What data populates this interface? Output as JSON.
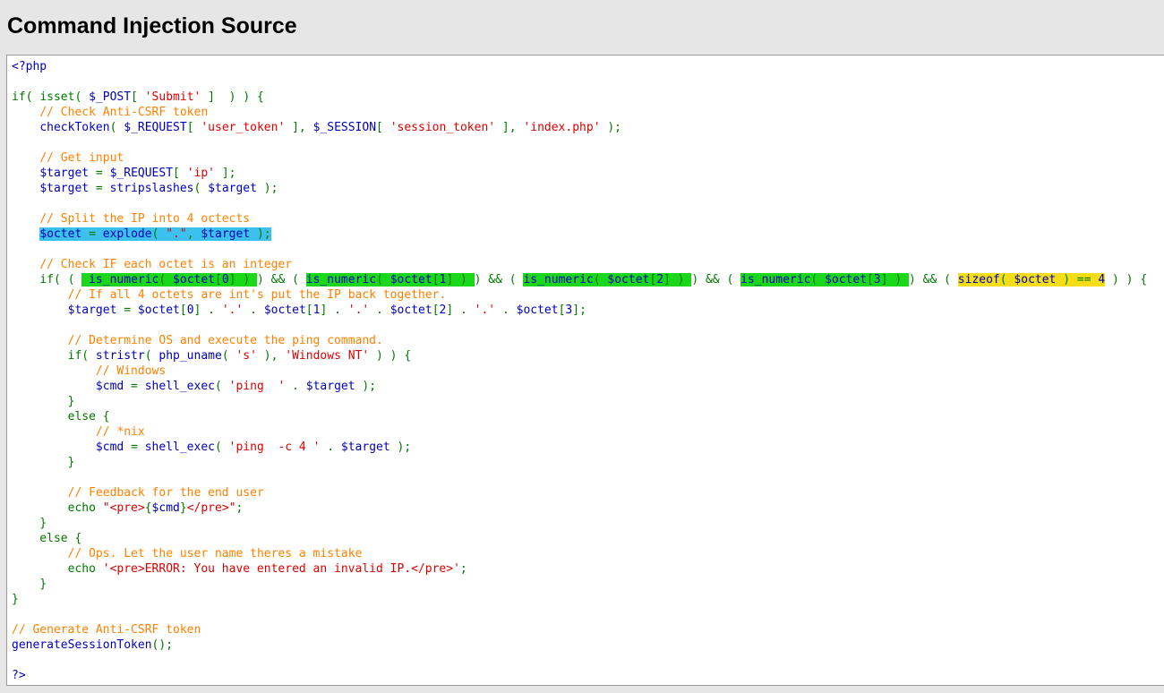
{
  "page": {
    "title": "Command Injection Source"
  },
  "colors": {
    "keyword": "#007700",
    "default": "#0000bb",
    "string": "#dd0000",
    "comment": "#ff8000",
    "highlight_blue": "#3cc1ee",
    "highlight_green": "#1ad71a",
    "highlight_yellow": "#f5dd17"
  },
  "code": {
    "lines": [
      [
        {
          "t": "<?php",
          "c": "dk"
        }
      ],
      [],
      [
        {
          "t": "if( ",
          "c": "kw"
        },
        {
          "t": "isset",
          "c": "kw"
        },
        {
          "t": "( ",
          "c": "kw"
        },
        {
          "t": "$_POST",
          "c": "dk"
        },
        {
          "t": "[ ",
          "c": "kw"
        },
        {
          "t": "'Submit'",
          "c": "str"
        },
        {
          "t": " ]  ) ) {",
          "c": "kw"
        }
      ],
      [
        {
          "t": "    ",
          "c": "kw"
        },
        {
          "t": "// Check Anti-CSRF token",
          "c": "cm"
        }
      ],
      [
        {
          "t": "    ",
          "c": "kw"
        },
        {
          "t": "checkToken",
          "c": "dk"
        },
        {
          "t": "( ",
          "c": "kw"
        },
        {
          "t": "$_REQUEST",
          "c": "dk"
        },
        {
          "t": "[ ",
          "c": "kw"
        },
        {
          "t": "'user_token'",
          "c": "str"
        },
        {
          "t": " ], ",
          "c": "kw"
        },
        {
          "t": "$_SESSION",
          "c": "dk"
        },
        {
          "t": "[ ",
          "c": "kw"
        },
        {
          "t": "'session_token'",
          "c": "str"
        },
        {
          "t": " ], ",
          "c": "kw"
        },
        {
          "t": "'index.php'",
          "c": "str"
        },
        {
          "t": " );",
          "c": "kw"
        }
      ],
      [],
      [
        {
          "t": "    ",
          "c": "kw"
        },
        {
          "t": "// Get input",
          "c": "cm"
        }
      ],
      [
        {
          "t": "    ",
          "c": "kw"
        },
        {
          "t": "$target",
          "c": "dk"
        },
        {
          "t": " = ",
          "c": "kw"
        },
        {
          "t": "$_REQUEST",
          "c": "dk"
        },
        {
          "t": "[ ",
          "c": "kw"
        },
        {
          "t": "'ip'",
          "c": "str"
        },
        {
          "t": " ];",
          "c": "kw"
        }
      ],
      [
        {
          "t": "    ",
          "c": "kw"
        },
        {
          "t": "$target",
          "c": "dk"
        },
        {
          "t": " = ",
          "c": "kw"
        },
        {
          "t": "stripslashes",
          "c": "dk"
        },
        {
          "t": "( ",
          "c": "kw"
        },
        {
          "t": "$target",
          "c": "dk"
        },
        {
          "t": " );",
          "c": "kw"
        }
      ],
      [],
      [
        {
          "t": "    ",
          "c": "kw"
        },
        {
          "t": "// Split the IP into 4 octects",
          "c": "cm"
        }
      ],
      [
        {
          "t": "    ",
          "c": "kw"
        },
        {
          "t": "$octet",
          "c": "dk",
          "h": "blue"
        },
        {
          "t": " = ",
          "c": "kw",
          "h": "blue"
        },
        {
          "t": "explode",
          "c": "dk",
          "h": "blue"
        },
        {
          "t": "( ",
          "c": "kw",
          "h": "blue"
        },
        {
          "t": "\".\"",
          "c": "str",
          "h": "blue"
        },
        {
          "t": ", ",
          "c": "kw",
          "h": "blue"
        },
        {
          "t": "$target",
          "c": "dk",
          "h": "blue"
        },
        {
          "t": " );",
          "c": "kw",
          "h": "blue"
        }
      ],
      [],
      [
        {
          "t": "    ",
          "c": "kw"
        },
        {
          "t": "// Check IF each octet is an integer",
          "c": "cm"
        }
      ],
      [
        {
          "t": "    if( ( ",
          "c": "kw"
        },
        {
          "t": " ",
          "c": "kw",
          "h": "green"
        },
        {
          "t": "is_numeric",
          "c": "dk",
          "h": "green"
        },
        {
          "t": "( ",
          "c": "kw",
          "h": "green"
        },
        {
          "t": "$octet",
          "c": "dk",
          "h": "green"
        },
        {
          "t": "[",
          "c": "kw",
          "h": "green"
        },
        {
          "t": "0",
          "c": "dk",
          "h": "green"
        },
        {
          "t": "] ) ",
          "c": "kw",
          "h": "green"
        },
        {
          "t": ") && ( ",
          "c": "kw"
        },
        {
          "t": "is_numeric",
          "c": "dk",
          "h": "green"
        },
        {
          "t": "( ",
          "c": "kw",
          "h": "green"
        },
        {
          "t": "$octet",
          "c": "dk",
          "h": "green"
        },
        {
          "t": "[",
          "c": "kw",
          "h": "green"
        },
        {
          "t": "1",
          "c": "dk",
          "h": "green"
        },
        {
          "t": "] ) ",
          "c": "kw",
          "h": "green"
        },
        {
          "t": ") && ( ",
          "c": "kw"
        },
        {
          "t": "is_numeric",
          "c": "dk",
          "h": "green"
        },
        {
          "t": "( ",
          "c": "kw",
          "h": "green"
        },
        {
          "t": "$octet",
          "c": "dk",
          "h": "green"
        },
        {
          "t": "[",
          "c": "kw",
          "h": "green"
        },
        {
          "t": "2",
          "c": "dk",
          "h": "green"
        },
        {
          "t": "] ) ",
          "c": "kw",
          "h": "green"
        },
        {
          "t": ") && ( ",
          "c": "kw"
        },
        {
          "t": "is_numeric",
          "c": "dk",
          "h": "green"
        },
        {
          "t": "( ",
          "c": "kw",
          "h": "green"
        },
        {
          "t": "$octet",
          "c": "dk",
          "h": "green"
        },
        {
          "t": "[",
          "c": "kw",
          "h": "green"
        },
        {
          "t": "3",
          "c": "dk",
          "h": "green"
        },
        {
          "t": "] ) ",
          "c": "kw",
          "h": "green"
        },
        {
          "t": ") && ( ",
          "c": "kw"
        },
        {
          "t": "sizeof",
          "c": "dk",
          "h": "yellow"
        },
        {
          "t": "( ",
          "c": "kw",
          "h": "yellow"
        },
        {
          "t": "$octet",
          "c": "dk",
          "h": "yellow"
        },
        {
          "t": " ) == ",
          "c": "kw",
          "h": "yellow"
        },
        {
          "t": "4",
          "c": "dk",
          "h": "yellow"
        },
        {
          "t": " ) ) {",
          "c": "kw"
        }
      ],
      [
        {
          "t": "        ",
          "c": "kw"
        },
        {
          "t": "// If all 4 octets are int's put the IP back together.",
          "c": "cm"
        }
      ],
      [
        {
          "t": "        ",
          "c": "kw"
        },
        {
          "t": "$target",
          "c": "dk"
        },
        {
          "t": " = ",
          "c": "kw"
        },
        {
          "t": "$octet",
          "c": "dk"
        },
        {
          "t": "[",
          "c": "kw"
        },
        {
          "t": "0",
          "c": "dk"
        },
        {
          "t": "] . ",
          "c": "kw"
        },
        {
          "t": "'.'",
          "c": "str"
        },
        {
          "t": " . ",
          "c": "kw"
        },
        {
          "t": "$octet",
          "c": "dk"
        },
        {
          "t": "[",
          "c": "kw"
        },
        {
          "t": "1",
          "c": "dk"
        },
        {
          "t": "] . ",
          "c": "kw"
        },
        {
          "t": "'.'",
          "c": "str"
        },
        {
          "t": " . ",
          "c": "kw"
        },
        {
          "t": "$octet",
          "c": "dk"
        },
        {
          "t": "[",
          "c": "kw"
        },
        {
          "t": "2",
          "c": "dk"
        },
        {
          "t": "] . ",
          "c": "kw"
        },
        {
          "t": "'.'",
          "c": "str"
        },
        {
          "t": " . ",
          "c": "kw"
        },
        {
          "t": "$octet",
          "c": "dk"
        },
        {
          "t": "[",
          "c": "kw"
        },
        {
          "t": "3",
          "c": "dk"
        },
        {
          "t": "];",
          "c": "kw"
        }
      ],
      [],
      [
        {
          "t": "        ",
          "c": "kw"
        },
        {
          "t": "// Determine OS and execute the ping command.",
          "c": "cm"
        }
      ],
      [
        {
          "t": "        if( ",
          "c": "kw"
        },
        {
          "t": "stristr",
          "c": "dk"
        },
        {
          "t": "( ",
          "c": "kw"
        },
        {
          "t": "php_uname",
          "c": "dk"
        },
        {
          "t": "( ",
          "c": "kw"
        },
        {
          "t": "'s'",
          "c": "str"
        },
        {
          "t": " ), ",
          "c": "kw"
        },
        {
          "t": "'Windows NT'",
          "c": "str"
        },
        {
          "t": " ) ) {",
          "c": "kw"
        }
      ],
      [
        {
          "t": "            ",
          "c": "kw"
        },
        {
          "t": "// Windows",
          "c": "cm"
        }
      ],
      [
        {
          "t": "            ",
          "c": "kw"
        },
        {
          "t": "$cmd",
          "c": "dk"
        },
        {
          "t": " = ",
          "c": "kw"
        },
        {
          "t": "shell_exec",
          "c": "dk"
        },
        {
          "t": "( ",
          "c": "kw"
        },
        {
          "t": "'ping  '",
          "c": "str"
        },
        {
          "t": " . ",
          "c": "kw"
        },
        {
          "t": "$target",
          "c": "dk"
        },
        {
          "t": " );",
          "c": "kw"
        }
      ],
      [
        {
          "t": "        }",
          "c": "kw"
        }
      ],
      [
        {
          "t": "        else {",
          "c": "kw"
        }
      ],
      [
        {
          "t": "            ",
          "c": "kw"
        },
        {
          "t": "// *nix",
          "c": "cm"
        }
      ],
      [
        {
          "t": "            ",
          "c": "kw"
        },
        {
          "t": "$cmd",
          "c": "dk"
        },
        {
          "t": " = ",
          "c": "kw"
        },
        {
          "t": "shell_exec",
          "c": "dk"
        },
        {
          "t": "( ",
          "c": "kw"
        },
        {
          "t": "'ping  -c 4 '",
          "c": "str"
        },
        {
          "t": " . ",
          "c": "kw"
        },
        {
          "t": "$target",
          "c": "dk"
        },
        {
          "t": " );",
          "c": "kw"
        }
      ],
      [
        {
          "t": "        }",
          "c": "kw"
        }
      ],
      [],
      [
        {
          "t": "        ",
          "c": "kw"
        },
        {
          "t": "// Feedback for the end user",
          "c": "cm"
        }
      ],
      [
        {
          "t": "        echo ",
          "c": "kw"
        },
        {
          "t": "\"<pre>",
          "c": "str"
        },
        {
          "t": "{",
          "c": "kw"
        },
        {
          "t": "$cmd",
          "c": "dk"
        },
        {
          "t": "}",
          "c": "kw"
        },
        {
          "t": "</pre>\"",
          "c": "str"
        },
        {
          "t": ";",
          "c": "kw"
        }
      ],
      [
        {
          "t": "    }",
          "c": "kw"
        }
      ],
      [
        {
          "t": "    else {",
          "c": "kw"
        }
      ],
      [
        {
          "t": "        ",
          "c": "kw"
        },
        {
          "t": "// Ops. Let the user name theres a mistake",
          "c": "cm"
        }
      ],
      [
        {
          "t": "        echo ",
          "c": "kw"
        },
        {
          "t": "'<pre>ERROR: You have entered an invalid IP.</pre>'",
          "c": "str"
        },
        {
          "t": ";",
          "c": "kw"
        }
      ],
      [
        {
          "t": "    }",
          "c": "kw"
        }
      ],
      [
        {
          "t": "}",
          "c": "kw"
        }
      ],
      [],
      [
        {
          "t": "// Generate Anti-CSRF token",
          "c": "cm"
        }
      ],
      [
        {
          "t": "generateSessionToken",
          "c": "dk"
        },
        {
          "t": "();",
          "c": "kw"
        }
      ],
      [],
      [
        {
          "t": "?>",
          "c": "dk"
        }
      ]
    ]
  }
}
